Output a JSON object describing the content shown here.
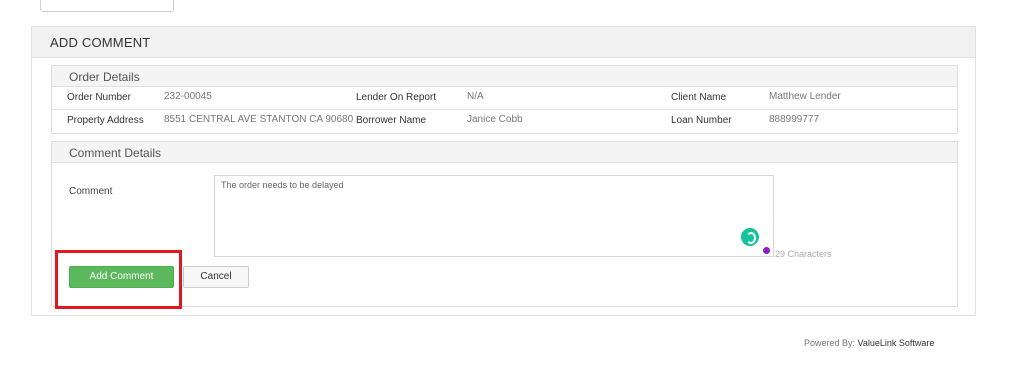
{
  "panel": {
    "title": "ADD COMMENT"
  },
  "order_details": {
    "title": "Order Details",
    "rows": [
      [
        {
          "label": "Order Number",
          "value": "232-00045"
        },
        {
          "label": "Lender On Report",
          "value": "N/A"
        },
        {
          "label": "Client Name",
          "value": "Matthew Lender"
        }
      ],
      [
        {
          "label": "Property Address",
          "value": "8551 CENTRAL AVE STANTON CA 90680"
        },
        {
          "label": "Borrower Name",
          "value": "Janice Cobb"
        },
        {
          "label": "Loan Number",
          "value": "888999777"
        }
      ]
    ]
  },
  "comment_details": {
    "title": "Comment Details",
    "comment_label": "Comment",
    "comment_value": "The order needs to be delayed",
    "char_count": "29 Characters",
    "add_button": "Add Comment",
    "cancel_button": "Cancel"
  },
  "footer": {
    "powered_prefix": "Powered By:",
    "brand": "ValueLink Software"
  },
  "colors": {
    "add_button": "#5cb85c",
    "highlight": "#e0191e",
    "grammar_badge": "#15c39a"
  }
}
